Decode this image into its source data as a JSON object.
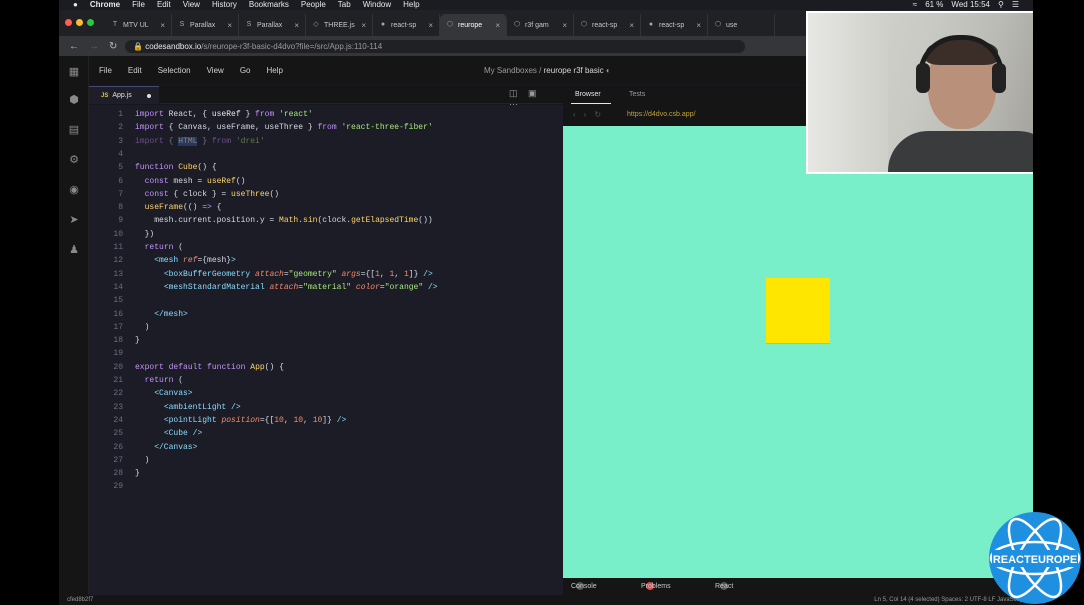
{
  "menubar": {
    "app": "Chrome",
    "items": [
      "File",
      "Edit",
      "View",
      "History",
      "Bookmarks",
      "People",
      "Tab",
      "Window",
      "Help"
    ],
    "battery": "61 %",
    "clock": "Wed 15:54"
  },
  "tabs": [
    {
      "label": "MTV UL"
    },
    {
      "label": "Parallax"
    },
    {
      "label": "Parallax"
    },
    {
      "label": "THREE.js"
    },
    {
      "label": "react-sp"
    },
    {
      "label": "reurope"
    },
    {
      "label": "r3f gam"
    },
    {
      "label": "react-sp"
    },
    {
      "label": "react-sp"
    },
    {
      "label": "use"
    }
  ],
  "address": {
    "host": "codesandbox.io",
    "path": "/s/reurope-r3f-basic-d4dvo?file=/src/App.js:110-114"
  },
  "editor_menu": [
    "File",
    "Edit",
    "Selection",
    "View",
    "Go",
    "Help"
  ],
  "breadcrumb": {
    "parent": "My Sandboxes",
    "sep": "/",
    "current": "reurope r3f basic"
  },
  "file_tab": {
    "badge": "JS",
    "name": "App.js"
  },
  "preview": {
    "tab_browser": "Browser",
    "tab_tests": "Tests",
    "url": "https://d4dvo.csb.app/"
  },
  "bottom": {
    "console": "Console",
    "problems": "Problems",
    "devtools": "React DevTools"
  },
  "status": {
    "left": "cfed8b2f7",
    "right": "Ln 5, Col 14 (4 selected)    Spaces: 2    UTF-8    LF    JavaScript"
  },
  "colors": {
    "canvas": "#78efc9",
    "cube": "#ffe600"
  },
  "code": [
    {
      "n": "1",
      "h": "<span class='kw'>import</span> React, { <span class='pr'>useRef</span> } <span class='kw'>from</span> <span class='str'>'react'</span>"
    },
    {
      "n": "2",
      "h": "<span class='kw'>import</span> { Canvas, useFrame, useThree } <span class='kw'>from</span> <span class='str'>'react-three-fiber'</span>"
    },
    {
      "n": "3",
      "h": "<span class='muted'><span class='kw'>import</span> { <span class='sel'>HTML</span> } <span class='kw'>from</span> <span class='str'>'drei'</span></span>"
    },
    {
      "n": "4",
      "h": ""
    },
    {
      "n": "5",
      "h": "<span class='kw'>function</span> <span class='fn'>Cube</span>() {"
    },
    {
      "n": "6",
      "h": "  <span class='kw'>const</span> mesh = <span class='fn'>useRef</span>()"
    },
    {
      "n": "7",
      "h": "  <span class='kw'>const</span> { clock } = <span class='fn'>useThree</span>()"
    },
    {
      "n": "8",
      "h": "  <span class='fn'>useFrame</span>(() <span class='kw'>=&gt;</span> {"
    },
    {
      "n": "9",
      "h": "    mesh.current.position.y = <span class='fn'>Math</span>.<span class='fn'>sin</span>(clock.<span class='fn'>getElapsedTime</span>())"
    },
    {
      "n": "10",
      "h": "  })"
    },
    {
      "n": "11",
      "h": "  <span class='kw'>return</span> ("
    },
    {
      "n": "12",
      "h": "    <span class='tag'>&lt;mesh</span> <span class='attr'>ref</span>={mesh}<span class='tag'>&gt;</span>"
    },
    {
      "n": "13",
      "h": "      <span class='tag'>&lt;boxBufferGeometry</span> <span class='attr'>attach</span>=<span class='str'>\"geometry\"</span> <span class='attr'>args</span>={[<span class='num'>1</span>, <span class='num'>1</span>, <span class='num'>1</span>]} <span class='tag'>/&gt;</span>"
    },
    {
      "n": "14",
      "h": "      <span class='tag'>&lt;meshStandardMaterial</span> <span class='attr'>attach</span>=<span class='str'>\"material\"</span> <span class='attr'>color</span>=<span class='str'>\"orange\"</span> <span class='tag'>/&gt;</span>"
    },
    {
      "n": "15",
      "h": ""
    },
    {
      "n": "16",
      "h": "    <span class='tag'>&lt;/mesh&gt;</span>"
    },
    {
      "n": "17",
      "h": "  )"
    },
    {
      "n": "18",
      "h": "}"
    },
    {
      "n": "19",
      "h": ""
    },
    {
      "n": "20",
      "h": "<span class='kw'>export</span> <span class='kw'>default</span> <span class='kw'>function</span> <span class='fn'>App</span>() {"
    },
    {
      "n": "21",
      "h": "  <span class='kw'>return</span> ("
    },
    {
      "n": "22",
      "h": "    <span class='tag'>&lt;Canvas&gt;</span>"
    },
    {
      "n": "23",
      "h": "      <span class='tag'>&lt;ambientLight</span> <span class='tag'>/&gt;</span>"
    },
    {
      "n": "24",
      "h": "      <span class='tag'>&lt;pointLight</span> <span class='attr'>position</span>={[<span class='num'>10</span>, <span class='num'>10</span>, <span class='num'>10</span>]} <span class='tag'>/&gt;</span>"
    },
    {
      "n": "25",
      "h": "      <span class='tag'>&lt;Cube</span> <span class='tag'>/&gt;</span>"
    },
    {
      "n": "26",
      "h": "    <span class='tag'>&lt;/Canvas&gt;</span>"
    },
    {
      "n": "27",
      "h": "  )"
    },
    {
      "n": "28",
      "h": "}"
    },
    {
      "n": "29",
      "h": ""
    }
  ],
  "logo": {
    "line1": "REACT",
    "line2": "EUROPE"
  }
}
